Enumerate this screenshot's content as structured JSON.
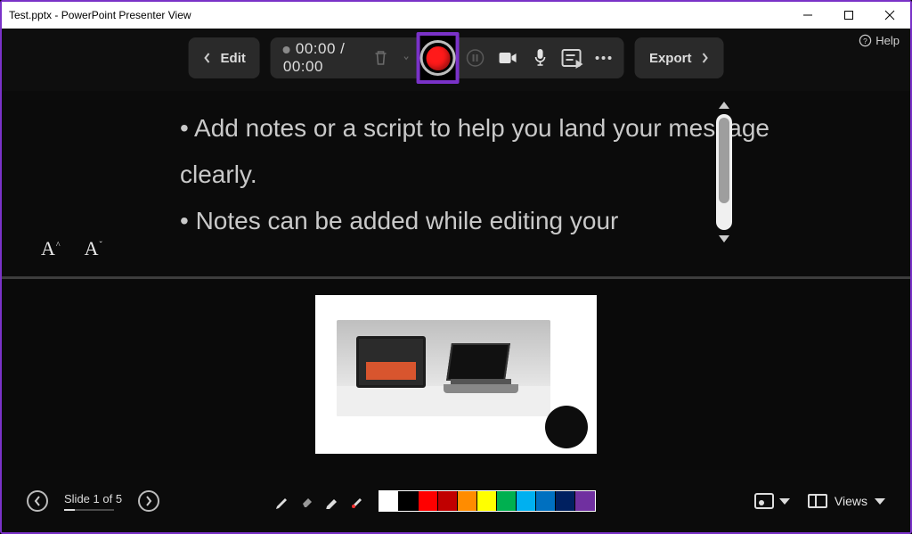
{
  "titlebar": {
    "title": "Test.pptx - PowerPoint Presenter View"
  },
  "help": {
    "label": "Help"
  },
  "toolbar": {
    "edit_label": "Edit",
    "time": "00:00 / 00:00",
    "export_label": "Export"
  },
  "notes": {
    "line1": "• Add notes or a script to help you land your message clearly.",
    "line2": "• Notes can be added while editing your"
  },
  "footer": {
    "slide_counter": "Slide 1 of 5",
    "views_label": "Views"
  },
  "palette": [
    "#ffffff",
    "#000000",
    "#ff0000",
    "#c00000",
    "#ff8c00",
    "#ffff00",
    "#00b050",
    "#00b0f0",
    "#0070c0",
    "#002060",
    "#7030a0"
  ],
  "accent_color": "#7a32c8"
}
